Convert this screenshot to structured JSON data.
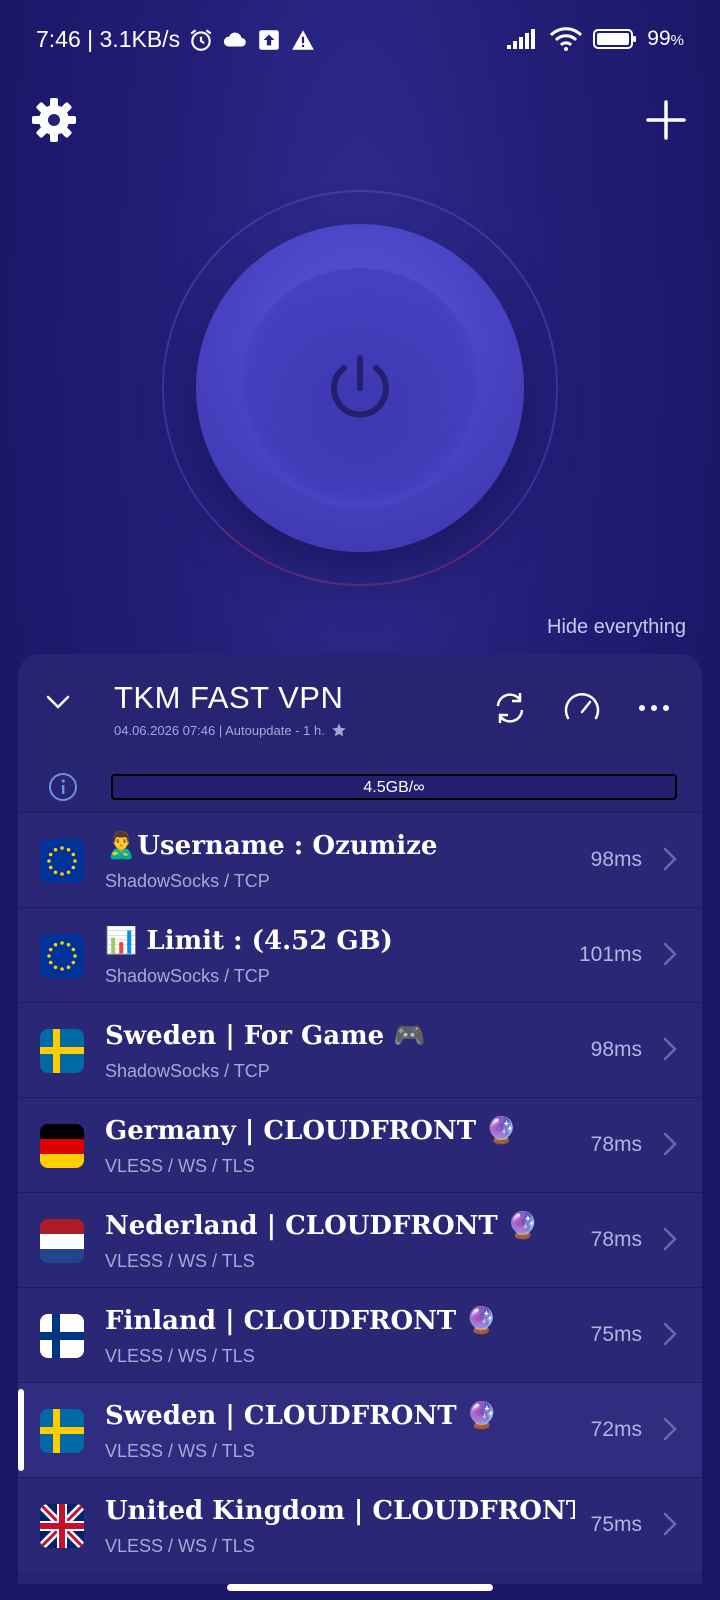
{
  "status": {
    "time_speed": "7:46 | 3.1KB/s",
    "battery": "99"
  },
  "power": {
    "state": "off"
  },
  "hide_everything": "Hide everything",
  "subscription": {
    "name": "TKM FAST VPN",
    "meta": "04.06.2026 07:46 | Autoupdate - 1 h.",
    "usage": "4.5GB/∞",
    "usage_fraction": 0
  },
  "servers": [
    {
      "flag": "eu",
      "name": "🙎‍♂️Username : Ozumize",
      "protocol": "ShadowSocks / TCP",
      "ping": "98ms",
      "selected": false
    },
    {
      "flag": "eu",
      "name": "📊 Limit : (4.52 GB)",
      "protocol": "ShadowSocks / TCP",
      "ping": "101ms",
      "selected": false
    },
    {
      "flag": "se",
      "name": "Sweden | For Game 🎮",
      "protocol": "ShadowSocks / TCP",
      "ping": "98ms",
      "selected": false
    },
    {
      "flag": "de",
      "name": "Germany | CLOUDFRONT 🔮",
      "protocol": "VLESS / WS / TLS",
      "ping": "78ms",
      "selected": false
    },
    {
      "flag": "nl",
      "name": "Nederland | CLOUDFRONT 🔮",
      "protocol": "VLESS / WS / TLS",
      "ping": "78ms",
      "selected": false
    },
    {
      "flag": "fi",
      "name": "Finland | CLOUDFRONT 🔮",
      "protocol": "VLESS / WS / TLS",
      "ping": "75ms",
      "selected": false
    },
    {
      "flag": "se",
      "name": "Sweden | CLOUDFRONT 🔮",
      "protocol": "VLESS / WS / TLS",
      "ping": "72ms",
      "selected": true
    },
    {
      "flag": "gb",
      "name": "United Kingdom | CLOUDFRONT ...",
      "protocol": "VLESS / WS / TLS",
      "ping": "75ms",
      "selected": false
    }
  ],
  "colors": {
    "accent": "#4a44c6",
    "panel": "#272472",
    "background": "#1b186a"
  }
}
